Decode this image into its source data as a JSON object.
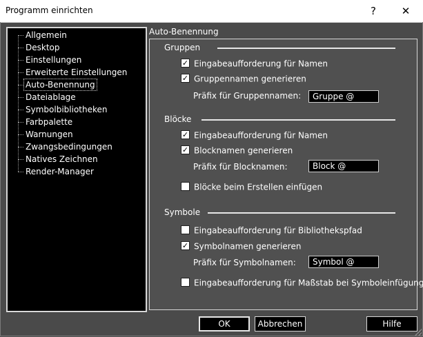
{
  "window": {
    "title": "Programm einrichten",
    "help_glyph": "?",
    "close_glyph": "✕"
  },
  "sidebar": {
    "items": [
      {
        "label": "Allgemein"
      },
      {
        "label": "Desktop"
      },
      {
        "label": "Einstellungen"
      },
      {
        "label": "Erweiterte Einstellungen"
      },
      {
        "label": "Auto-Benennung",
        "selected": true
      },
      {
        "label": "Dateiablage"
      },
      {
        "label": "Symbolbibliotheken"
      },
      {
        "label": "Farbpalette"
      },
      {
        "label": "Warnungen"
      },
      {
        "label": "Zwangsbedingungen"
      },
      {
        "label": "Natives Zeichnen"
      },
      {
        "label": "Render-Manager"
      }
    ]
  },
  "panel": {
    "title": "Auto-Benennung",
    "gruppen": {
      "label": "Gruppen",
      "prompt": {
        "label": "Eingabeaufforderung für Namen",
        "checked": true
      },
      "generate": {
        "label": "Gruppennamen generieren",
        "checked": true
      },
      "prefix_label": "Präfix für Gruppennamen:",
      "prefix_value": "Gruppe @"
    },
    "bloecke": {
      "label": "Blöcke",
      "prompt": {
        "label": "Eingabeaufforderung für Namen",
        "checked": true
      },
      "generate": {
        "label": "Blocknamen generieren",
        "checked": true
      },
      "prefix_label": "Präfix für Blocknamen:",
      "prefix_value": "Block @",
      "insert": {
        "label": "Blöcke beim Erstellen einfügen",
        "checked": false
      }
    },
    "symbole": {
      "label": "Symbole",
      "prompt_lib": {
        "label": "Eingabeaufforderung für Bibliothekspfad",
        "checked": false
      },
      "generate": {
        "label": "Symbolnamen generieren",
        "checked": true
      },
      "prefix_label": "Präfix für Symbolnamen:",
      "prefix_value": "Symbol @",
      "prompt_scale": {
        "label": "Eingabeaufforderung für Maßstab bei Symboleinfügung",
        "checked": false
      }
    }
  },
  "buttons": {
    "ok": "OK",
    "cancel": "Abbrechen",
    "help": "Hilfe"
  },
  "colors": {
    "background": "#4a4a4a",
    "panel": "#505050",
    "field": "#000000",
    "text": "#ffffff"
  }
}
